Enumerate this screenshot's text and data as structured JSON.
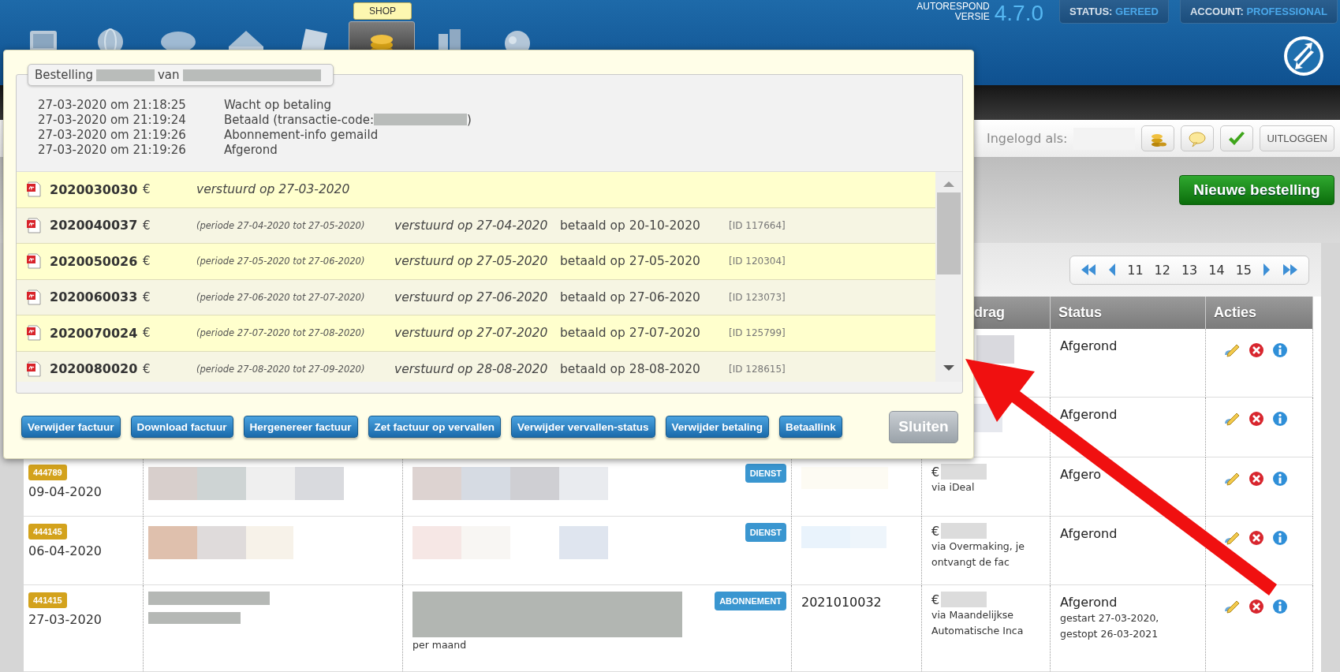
{
  "header": {
    "nav": {
      "tooltip": "SHOP",
      "items": [
        {
          "selected": false
        },
        {
          "selected": false
        },
        {
          "selected": false
        },
        {
          "selected": false
        },
        {
          "selected": false
        },
        {
          "selected": true
        },
        {
          "selected": false
        },
        {
          "selected": false
        }
      ]
    },
    "version": {
      "label_lines": [
        "AUTORESPOND",
        "VERSIE"
      ],
      "number": "4.7.0"
    },
    "status_buttons": [
      {
        "label": "STATUS:",
        "value": "GEREED"
      },
      {
        "label": "ACCOUNT:",
        "value": "PROFESSIONAL"
      }
    ]
  },
  "toolbar": {
    "logged_in_label": "Ingelogd als:",
    "buttons": [
      {
        "kind": "icon"
      },
      {
        "kind": "icon"
      },
      {
        "kind": "icon"
      },
      {
        "kind": "text",
        "label": "UITLOGGEN"
      }
    ]
  },
  "new_order_button": "Nieuwe bestelling",
  "pagination": {
    "pages": [
      "11",
      "12",
      "13",
      "14",
      "15"
    ]
  },
  "table": {
    "columns": [
      "drag",
      "Status",
      "Acties"
    ],
    "rows": [
      {
        "status": "Afgerond"
      },
      {
        "status": "Afgerond"
      },
      {
        "order": "444789",
        "date": "09-04-2020",
        "tag": "DIENST",
        "currency": "€",
        "payment": [
          "via iDeal"
        ],
        "status": "Afgero"
      },
      {
        "order": "444145",
        "date": "06-04-2020",
        "tag": "DIENST",
        "currency": "€",
        "payment": [
          "via Overmaking, je",
          "ontvangt de fac"
        ],
        "status": "Afgerond"
      },
      {
        "order": "441415",
        "date": "27-03-2020",
        "tag": "ABONNEMENT",
        "product_note": "per maand",
        "invoice": "2021010032",
        "currency": "€",
        "payment": [
          "via Maandelijkse",
          "Automatische Inca"
        ],
        "status": "Afgerond",
        "status_notes": [
          "gestart 27-03-2020,",
          "gestopt 26-03-2021"
        ]
      }
    ]
  },
  "dialog": {
    "title_parts": [
      "Bestelling",
      "van"
    ],
    "log": [
      {
        "time": "27-03-2020 om 21:18:25",
        "event": "Wacht op betaling"
      },
      {
        "time": "27-03-2020 om 21:19:24",
        "event": "Betaald (transactie-code:",
        "event_end": ")"
      },
      {
        "time": "27-03-2020 om 21:19:26",
        "event": "Abonnement-info gemaild"
      },
      {
        "time": "27-03-2020 om 21:19:26",
        "event": "Afgerond"
      }
    ],
    "invoices": [
      {
        "number": "2020030030",
        "currency": "€",
        "sent": "verstuurd op 27-03-2020"
      },
      {
        "number": "2020040037",
        "currency": "€",
        "period": "(periode 27-04-2020 tot 27-05-2020)",
        "sent": "verstuurd op 27-04-2020",
        "paid": "betaald op 20-10-2020",
        "id": "[ID 117664]"
      },
      {
        "number": "2020050026",
        "currency": "€",
        "period": "(periode 27-05-2020 tot 27-06-2020)",
        "sent": "verstuurd op 27-05-2020",
        "paid": "betaald op 27-05-2020",
        "id": "[ID 120304]"
      },
      {
        "number": "2020060033",
        "currency": "€",
        "period": "(periode 27-06-2020 tot 27-07-2020)",
        "sent": "verstuurd op 27-06-2020",
        "paid": "betaald op 27-06-2020",
        "id": "[ID 123073]"
      },
      {
        "number": "2020070024",
        "currency": "€",
        "period": "(periode 27-07-2020 tot 27-08-2020)",
        "sent": "verstuurd op 27-07-2020",
        "paid": "betaald op 27-07-2020",
        "id": "[ID 125799]"
      },
      {
        "number": "2020080020",
        "currency": "€",
        "period": "(periode 27-08-2020 tot 27-09-2020)",
        "sent": "verstuurd op 28-08-2020",
        "paid": "betaald op 28-08-2020",
        "id": "[ID 128615]"
      }
    ],
    "actions": [
      "Verwijder factuur",
      "Download factuur",
      "Hergenereer factuur",
      "Zet factuur op vervallen",
      "Verwijder vervallen-status",
      "Verwijder betaling",
      "Betaallink"
    ],
    "close": "Sluiten"
  }
}
